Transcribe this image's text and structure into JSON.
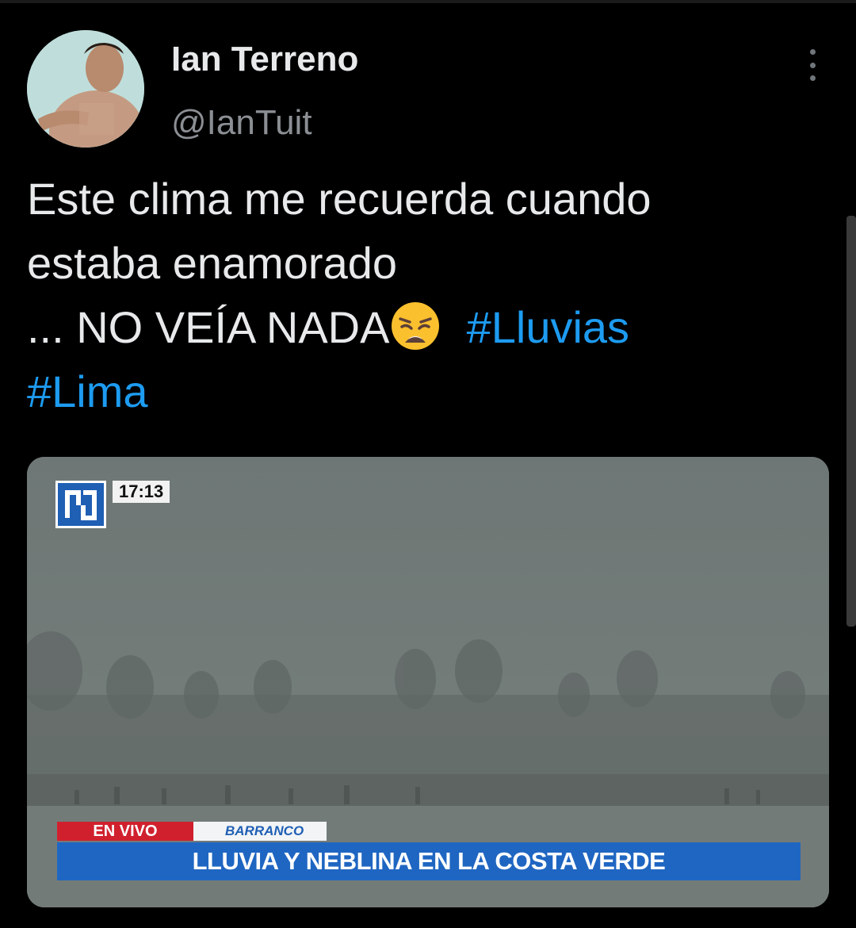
{
  "tweet": {
    "author_name": "Ian Terreno",
    "author_handle": "@IanTuit",
    "text_line1": "Este clima me recuerda cuando",
    "text_line2": "estaba enamorado",
    "text_line3": "... NO VEÍA NADA",
    "emoji_icon": "weary-face-icon",
    "hashtag1": "#Lluvias",
    "hashtag2": "#Lima"
  },
  "media": {
    "clock": "17:13",
    "live_label": "EN VIVO",
    "location": "BARRANCO",
    "headline": "LLUVIA Y NEBLINA EN LA COSTA VERDE"
  },
  "colors": {
    "background": "#000000",
    "hashtag": "#1d9bf0",
    "live_red": "#d0202e",
    "ticker_blue": "#1f66c2"
  }
}
